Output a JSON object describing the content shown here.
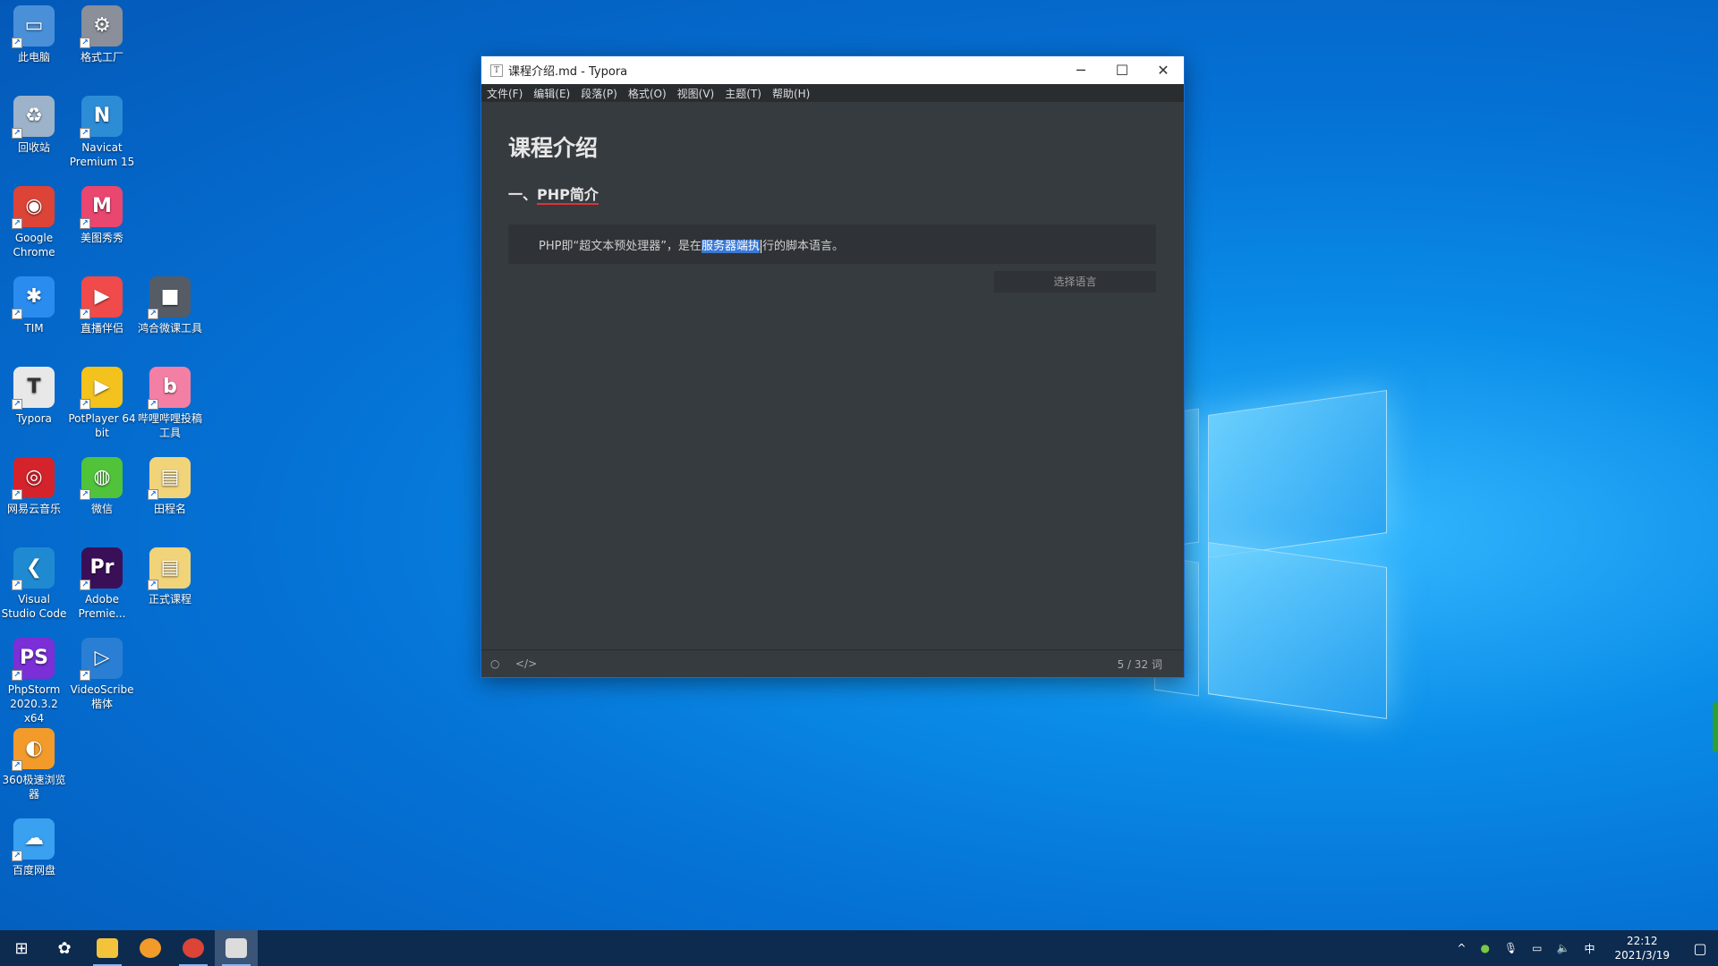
{
  "desktop": {
    "icons": [
      {
        "label": "此电脑",
        "color": "#4a90d9",
        "glyph": "▭"
      },
      {
        "label": "格式工厂",
        "color": "#8a8f99",
        "glyph": "⚙"
      },
      {
        "label": "回收站",
        "color": "#9db3c9",
        "glyph": "♻"
      },
      {
        "label": "Navicat Premium 15",
        "color": "#2d8cd6",
        "glyph": "N"
      },
      {
        "label": "Google Chrome",
        "color": "#db4437",
        "glyph": "◉"
      },
      {
        "label": "美图秀秀",
        "color": "#e94670",
        "glyph": "M"
      },
      {
        "label": "TIM",
        "color": "#2b8cf0",
        "glyph": "✱"
      },
      {
        "label": "直播伴侣",
        "color": "#f04a4a",
        "glyph": "▶"
      },
      {
        "label": "鸿合微课工具",
        "color": "#555c66",
        "glyph": "■"
      },
      {
        "label": "Typora",
        "color": "#e8e8e8",
        "glyph": "T"
      },
      {
        "label": "PotPlayer 64 bit",
        "color": "#f3c21c",
        "glyph": "▶"
      },
      {
        "label": "哔哩哔哩投稿工具",
        "color": "#f47fa5",
        "glyph": "b"
      },
      {
        "label": "网易云音乐",
        "color": "#d5232b",
        "glyph": "◎"
      },
      {
        "label": "微信",
        "color": "#50c33b",
        "glyph": "◍"
      },
      {
        "label": "田程名",
        "color": "#f1d37a",
        "glyph": "▤"
      },
      {
        "label": "Visual Studio Code",
        "color": "#1f8ad2",
        "glyph": "❮"
      },
      {
        "label": "Adobe Premie...",
        "color": "#3b0f58",
        "glyph": "Pr"
      },
      {
        "label": "正式课程",
        "color": "#f1d37a",
        "glyph": "▤"
      },
      {
        "label": "PhpStorm 2020.3.2 x64",
        "color": "#7b2fd6",
        "glyph": "PS"
      },
      {
        "label": "VideoScribe 楷体",
        "color": "#2a7fd4",
        "glyph": "▷"
      },
      {
        "label": "360极速浏览器",
        "color": "#f29b2b",
        "glyph": "◐"
      },
      {
        "label": "百度网盘",
        "color": "#3aa0f0",
        "glyph": "☁"
      }
    ]
  },
  "window": {
    "title": "课程介绍.md - Typora",
    "app_icon": "T",
    "buttons": {
      "minimize": "─",
      "maximize": "☐",
      "close": "✕"
    },
    "menu": [
      "文件(F)",
      "编辑(E)",
      "段落(P)",
      "格式(O)",
      "视图(V)",
      "主题(T)",
      "帮助(H)"
    ],
    "doc": {
      "h1": "课程介绍",
      "h2_prefix": "一、",
      "h2_text": "PHP简介",
      "code_before": "PHP即“超文本预处理器”，是在",
      "code_selected": "服务器端执",
      "code_after": "行的脚本语言。",
      "lang_placeholder": "选择语言"
    },
    "status": {
      "circle_icon": "○",
      "code_icon": "</>",
      "word_count": "5 / 32 词"
    }
  },
  "taskbar": {
    "time": "22:12",
    "date": "2021/3/19",
    "ime": "中",
    "apps": [
      {
        "name": "file-explorer",
        "color": "#f3c33b"
      },
      {
        "name": "360-browser",
        "color": "#f29b2b"
      },
      {
        "name": "chrome",
        "color": "#db4437"
      },
      {
        "name": "typora",
        "color": "#dcdcdc"
      }
    ]
  }
}
